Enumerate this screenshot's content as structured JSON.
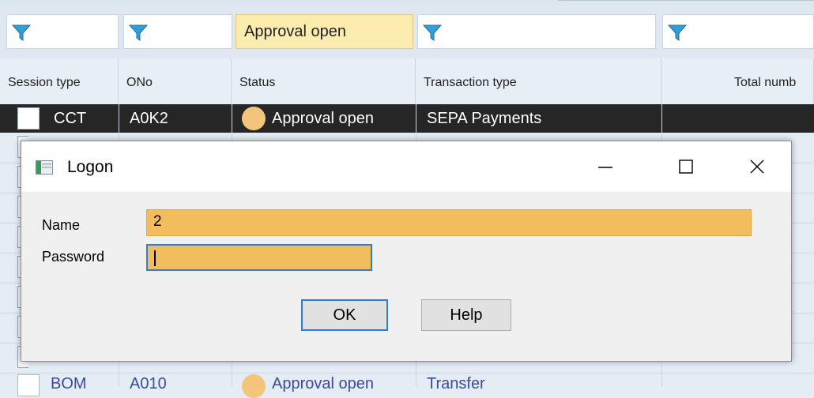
{
  "filters": {
    "status_value": "Approval open"
  },
  "columns": [
    "Session type",
    "ONo",
    "Status",
    "Transaction type",
    "Total numb"
  ],
  "selected_row": {
    "session_type": "CCT",
    "order_no": "A0K2",
    "status": "Approval open",
    "transaction_type": "SEPA Payments"
  },
  "last_row": {
    "session_type": "BOM",
    "order_no": "A010",
    "status": "Approval open",
    "transaction_type": "Transfer"
  },
  "dialog": {
    "title": "Logon",
    "name_label": "Name",
    "name_value": "2",
    "password_label": "Password",
    "password_value": "",
    "ok_label": "OK",
    "help_label": "Help"
  },
  "colors": {
    "field_highlight": "#f2bd5d",
    "selected_row": "#262626",
    "focus_border": "#2f7fd0",
    "status_dot": "#f3c57a",
    "filter_active": "#fcecb0"
  },
  "icons": [
    "filter-icon",
    "status-dot-icon",
    "app-window-icon",
    "minimize-icon",
    "maximize-icon",
    "close-icon"
  ]
}
